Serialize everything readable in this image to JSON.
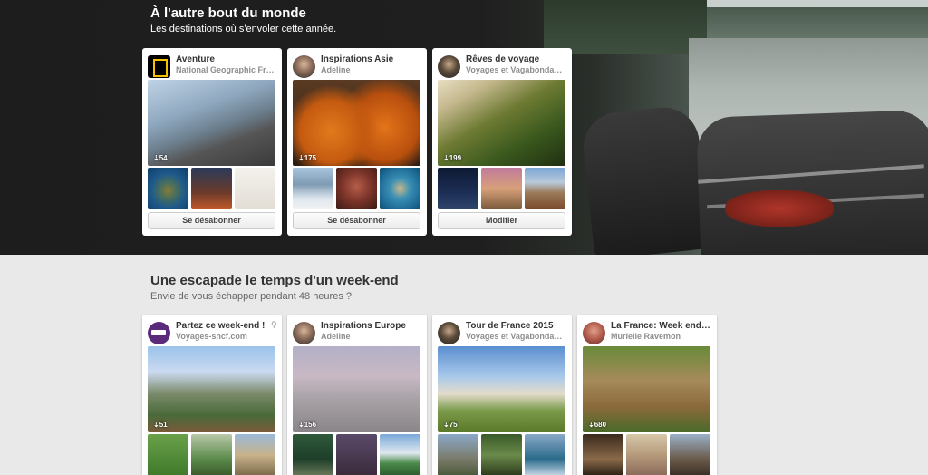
{
  "section1": {
    "title": "À l'autre bout du monde",
    "subtitle": "Les destinations où s'envoler cette année."
  },
  "section2": {
    "title": "Une escapade le temps d'un week-end",
    "subtitle": "Envie de vous échapper pendant 48 heures ?"
  },
  "boards_row1": [
    {
      "name": "Aventure",
      "owner": "National Geographic France",
      "pins": "54",
      "button": "Se désabonner"
    },
    {
      "name": "Inspirations Asie",
      "owner": "Adeline",
      "pins": "175",
      "button": "Se désabonner"
    },
    {
      "name": "Rêves de voyage",
      "owner": "Voyages et Vagabondages",
      "pins": "199",
      "button": "Modifier"
    }
  ],
  "boards_row2": [
    {
      "name": "Partez ce week-end !",
      "owner": "Voyages-sncf.com",
      "pins": "51"
    },
    {
      "name": "Inspirations Europe",
      "owner": "Adeline",
      "pins": "156"
    },
    {
      "name": "Tour de France 2015",
      "owner": "Voyages et Vagabondages",
      "pins": "75"
    },
    {
      "name": "La France: Week end…",
      "owner": "Murielle Ravemon",
      "pins": "680"
    }
  ],
  "icons": {
    "pin_count": "pin-icon",
    "promoted": "pin-marker-icon"
  }
}
